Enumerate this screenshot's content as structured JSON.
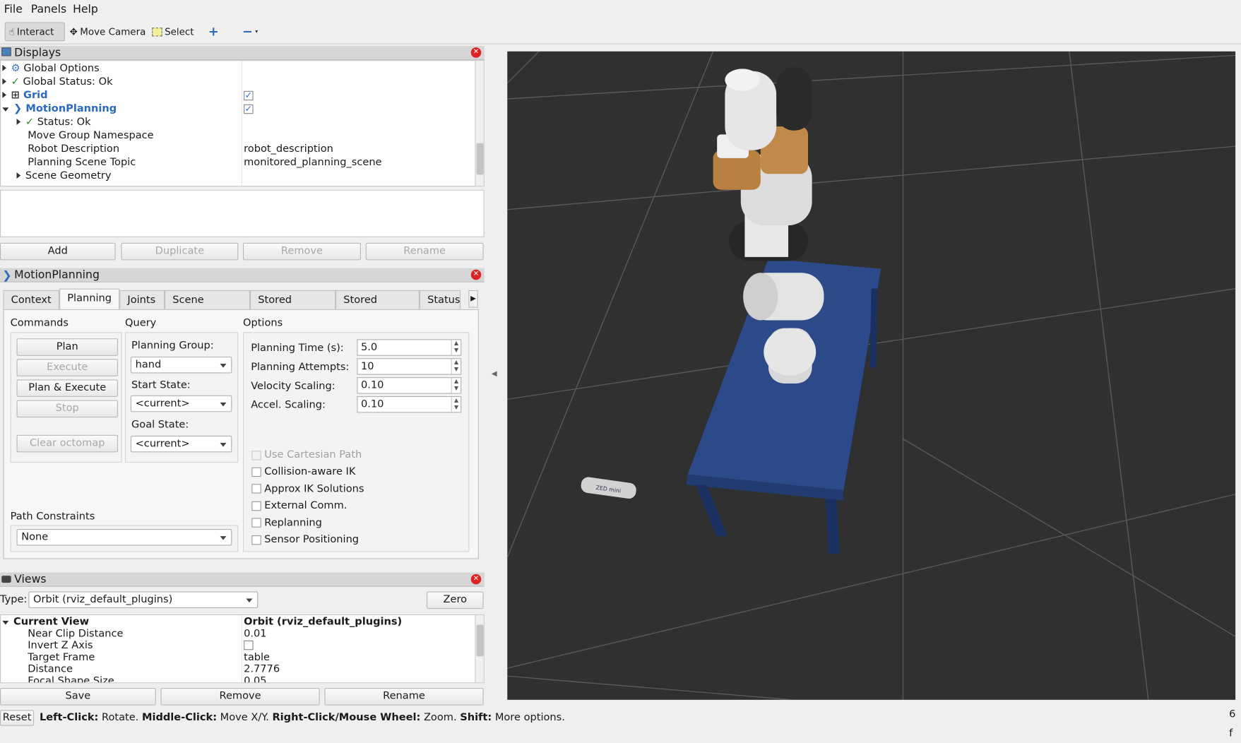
{
  "menu": {
    "file": "File",
    "panels": "Panels",
    "help": "Help"
  },
  "toolbar": {
    "interact": "Interact",
    "move_camera": "Move Camera",
    "select": "Select"
  },
  "displays": {
    "title": "Displays",
    "rows": [
      {
        "label": "Global Options",
        "value": ""
      },
      {
        "label": "Global Status: Ok",
        "value": ""
      },
      {
        "label": "Grid",
        "value": ""
      },
      {
        "label": "MotionPlanning",
        "value": ""
      },
      {
        "label": "Status: Ok",
        "value": ""
      },
      {
        "label": "Move Group Namespace",
        "value": ""
      },
      {
        "label": "Robot Description",
        "value": "robot_description"
      },
      {
        "label": "Planning Scene Topic",
        "value": "monitored_planning_scene"
      },
      {
        "label": "Scene Geometry",
        "value": ""
      }
    ],
    "buttons": {
      "add": "Add",
      "duplicate": "Duplicate",
      "remove": "Remove",
      "rename": "Rename"
    }
  },
  "motion": {
    "title": "MotionPlanning",
    "tabs": [
      "Context",
      "Planning",
      "Joints",
      "Scene Objects",
      "Stored Scenes",
      "Stored States",
      "Status"
    ],
    "commands": {
      "label": "Commands",
      "plan": "Plan",
      "execute": "Execute",
      "plan_execute": "Plan & Execute",
      "stop": "Stop",
      "clear": "Clear octomap"
    },
    "query": {
      "label": "Query",
      "group_label": "Planning Group:",
      "group": "hand",
      "start_label": "Start State:",
      "start": "<current>",
      "goal_label": "Goal State:",
      "goal": "<current>"
    },
    "options": {
      "label": "Options",
      "time_label": "Planning Time (s):",
      "time": "5.0",
      "attempts_label": "Planning Attempts:",
      "attempts": "10",
      "velocity_label": "Velocity Scaling:",
      "velocity": "0.10",
      "accel_label": "Accel. Scaling:",
      "accel": "0.10",
      "checks": [
        "Use Cartesian Path",
        "Collision-aware IK",
        "Approx IK Solutions",
        "External Comm.",
        "Replanning",
        "Sensor Positioning"
      ]
    },
    "path": {
      "label": "Path Constraints",
      "value": "None"
    }
  },
  "views": {
    "title": "Views",
    "type_label": "Type:",
    "type": "Orbit (rviz_default_plugins)",
    "zero": "Zero",
    "rows": [
      {
        "label": "Current View",
        "value": "Orbit (rviz_default_plugins)"
      },
      {
        "label": "Near Clip Distance",
        "value": "0.01"
      },
      {
        "label": "Invert Z Axis",
        "value": ""
      },
      {
        "label": "Target Frame",
        "value": "table"
      },
      {
        "label": "Distance",
        "value": "2.7776"
      },
      {
        "label": "Focal Shape Size",
        "value": "0.05"
      }
    ],
    "buttons": {
      "save": "Save",
      "remove": "Remove",
      "rename": "Rename"
    }
  },
  "status": {
    "reset": "Reset",
    "b1": "Left-Click:",
    "t1": " Rotate. ",
    "b2": "Middle-Click:",
    "t2": " Move X/Y. ",
    "b3": "Right-Click/Mouse Wheel:",
    "t3": " Zoom. ",
    "b4": "Shift:",
    "t4": " More options.",
    "fps": "6 f"
  },
  "scene": {
    "box_label": "ZED mini"
  },
  "colors": {
    "accent": "#2a6bbd",
    "table": "#2c4a8a",
    "background": "#303030"
  }
}
